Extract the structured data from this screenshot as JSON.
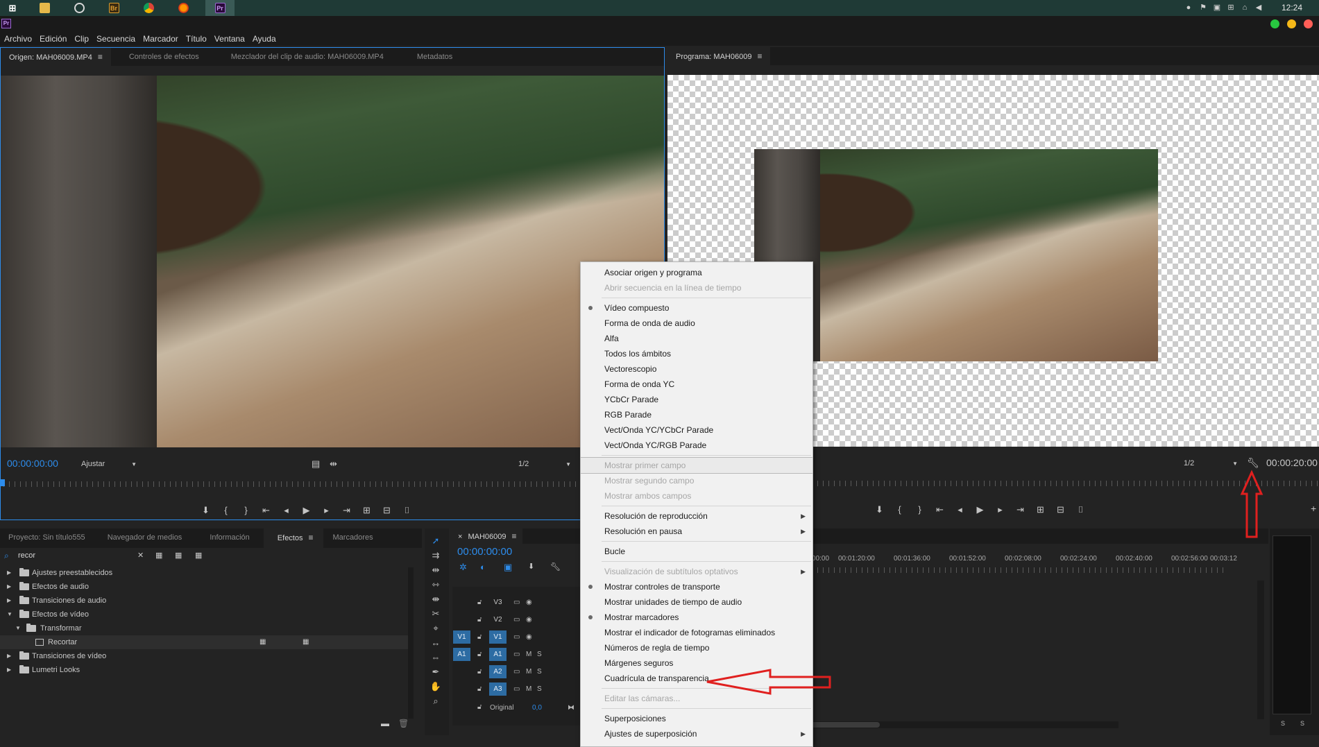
{
  "taskbar": {
    "clock": "12:24",
    "apps": [
      "windows-start",
      "file-explorer",
      "app-circle",
      "bridge",
      "chrome",
      "firefox",
      "premiere"
    ],
    "bridge_label": "Br",
    "premiere_label": "Pr"
  },
  "app": {
    "logo_label": "Pr"
  },
  "menubar": [
    "Archivo",
    "Edición",
    "Clip",
    "Secuencia",
    "Marcador",
    "Título",
    "Ventana",
    "Ayuda"
  ],
  "source_panel": {
    "tabs": [
      "Origen: MAH06009.MP4",
      "Controles de efectos",
      "Mezclador del clip de audio: MAH06009.MP4",
      "Metadatos"
    ],
    "timecode": "00:00:00:00",
    "fit": "Ajustar",
    "resolution": "1/2"
  },
  "program_panel": {
    "tab": "Programa: MAH06009",
    "resolution": "1/2",
    "timecode": "00:00:20:00"
  },
  "project_panel": {
    "tabs": [
      "Proyecto: Sin título555",
      "Navegador de medios",
      "Información",
      "Efectos",
      "Marcadores"
    ],
    "search_value": "recor",
    "tree": [
      {
        "label": "Ajustes preestablecidos",
        "level": 0,
        "expanded": false
      },
      {
        "label": "Efectos de audio",
        "level": 0,
        "expanded": false
      },
      {
        "label": "Transiciones de audio",
        "level": 0,
        "expanded": false
      },
      {
        "label": "Efectos de vídeo",
        "level": 0,
        "expanded": true
      },
      {
        "label": "Transformar",
        "level": 1,
        "expanded": true
      },
      {
        "label": "Recortar",
        "level": 2,
        "effect": true
      },
      {
        "label": "Transiciones de vídeo",
        "level": 0,
        "expanded": false
      },
      {
        "label": "Lumetri Looks",
        "level": 0,
        "expanded": false
      }
    ]
  },
  "timeline": {
    "tab": "MAH06009",
    "timecode": "00:00:00:00",
    "ruler": [
      "00:00",
      "00:01:20:00",
      "00:01:36:00",
      "00:01:52:00",
      "00:02:08:00",
      "00:02:24:00",
      "00:02:40:00",
      "00:02:56:00",
      "00:03:12"
    ],
    "video_tracks": [
      "V3",
      "V2",
      "V1"
    ],
    "audio_tracks": [
      "A1",
      "A2",
      "A3"
    ],
    "source_v": "V1",
    "source_a": "A1",
    "mute_label": "M",
    "solo_label": "S",
    "master_label": "Original",
    "master_value": "0,0",
    "meter_labels": [
      "S",
      "S"
    ]
  },
  "context_menu": {
    "items": [
      {
        "label": "Asociar origen y programa",
        "enabled": true
      },
      {
        "label": "Abrir secuencia en la línea de tiempo",
        "enabled": false
      },
      {
        "sep": true
      },
      {
        "label": "Vídeo compuesto",
        "enabled": true,
        "checked": true
      },
      {
        "label": "Forma de onda de audio",
        "enabled": true
      },
      {
        "label": "Alfa",
        "enabled": true
      },
      {
        "label": "Todos los ámbitos",
        "enabled": true
      },
      {
        "label": "Vectorescopio",
        "enabled": true
      },
      {
        "label": "Forma de onda YC",
        "enabled": true
      },
      {
        "label": "YCbCr Parade",
        "enabled": true
      },
      {
        "label": "RGB Parade",
        "enabled": true
      },
      {
        "label": "Vect/Onda YC/YCbCr Parade",
        "enabled": true
      },
      {
        "label": "Vect/Onda YC/RGB Parade",
        "enabled": true
      },
      {
        "sep": true
      },
      {
        "label": "Mostrar primer campo",
        "enabled": false,
        "hover": true
      },
      {
        "label": "Mostrar segundo campo",
        "enabled": false
      },
      {
        "label": "Mostrar ambos campos",
        "enabled": false
      },
      {
        "sep": true
      },
      {
        "label": "Resolución de reproducción",
        "enabled": true,
        "submenu": true
      },
      {
        "label": "Resolución en pausa",
        "enabled": true,
        "submenu": true
      },
      {
        "sep": true
      },
      {
        "label": "Bucle",
        "enabled": true
      },
      {
        "sep": true
      },
      {
        "label": "Visualización de subtítulos optativos",
        "enabled": false,
        "submenu": true
      },
      {
        "label": "Mostrar controles de transporte",
        "enabled": true,
        "checked": true
      },
      {
        "label": "Mostrar unidades de tiempo de audio",
        "enabled": true
      },
      {
        "label": "Mostrar marcadores",
        "enabled": true,
        "checked": true
      },
      {
        "label": "Mostrar el indicador de fotogramas eliminados",
        "enabled": true
      },
      {
        "label": "Números de regla de tiempo",
        "enabled": true
      },
      {
        "label": "Márgenes seguros",
        "enabled": true
      },
      {
        "label": "Cuadrícula de transparencia",
        "enabled": true
      },
      {
        "sep": true
      },
      {
        "label": "Editar las cámaras...",
        "enabled": false
      },
      {
        "sep": true
      },
      {
        "label": "Superposiciones",
        "enabled": true
      },
      {
        "label": "Ajustes de superposición",
        "enabled": true,
        "submenu": true
      }
    ]
  },
  "annotation_color": "#e0201f"
}
